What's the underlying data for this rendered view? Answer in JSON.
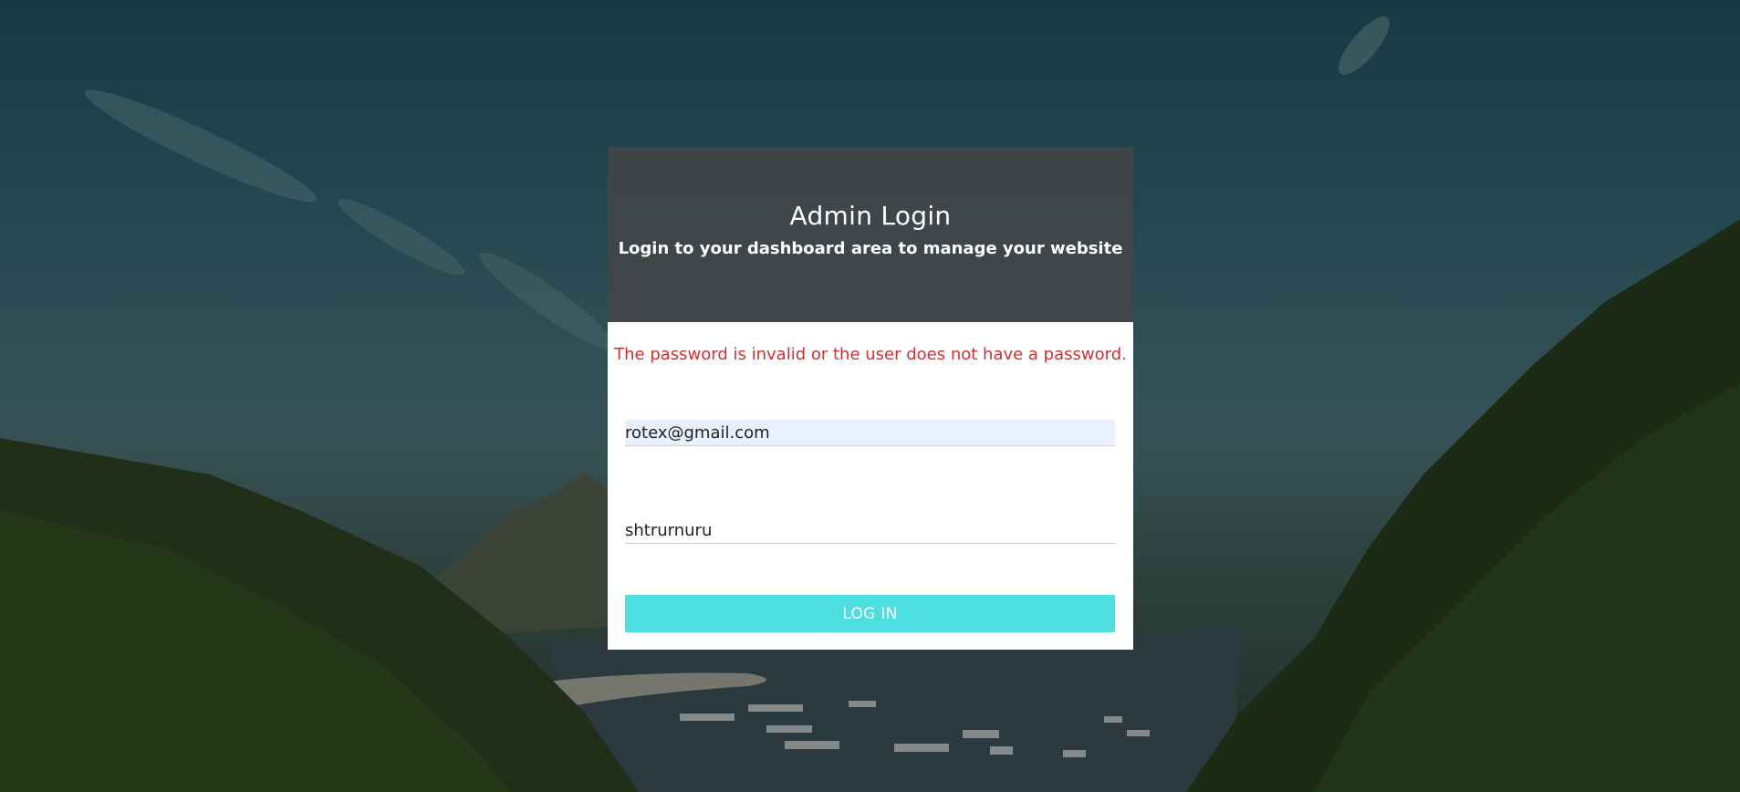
{
  "header": {
    "title": "Admin Login",
    "subtitle": "Login to your dashboard area to manage your website"
  },
  "form": {
    "error_message": "The password is invalid or the user does not have a password.",
    "email_value": "rotex@gmail.com",
    "password_value": "shtrurnuru",
    "login_label": "LOG IN"
  },
  "colors": {
    "error": "#d32f2f",
    "button": "#4ddfe0",
    "header_overlay": "#464646",
    "autofill": "#e8f0fe"
  }
}
